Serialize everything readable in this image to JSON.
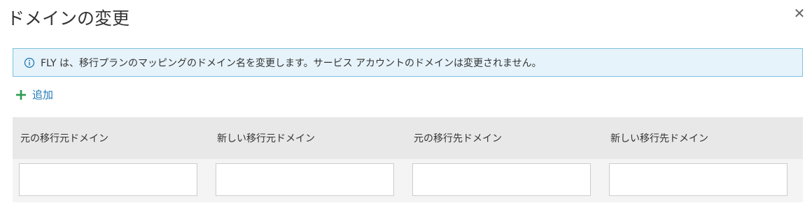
{
  "dialog": {
    "title": "ドメインの変更",
    "close_symbol": "✕",
    "info": {
      "icon": "info-icon",
      "text": "FLY は、移行プランのマッピングのドメイン名を変更します。サービス アカウントのドメインは変更されません。"
    },
    "add": {
      "icon": "plus-icon",
      "label": "追加"
    },
    "table": {
      "columns": [
        "元の移行元ドメイン",
        "新しい移行元ドメイン",
        "元の移行先ドメイン",
        "新しい移行先ドメイン"
      ],
      "row": [
        "",
        "",
        "",
        ""
      ]
    },
    "colors": {
      "accent": "#1f78b4",
      "add_icon": "#2e9a52",
      "banner_bg": "#e6f3fa",
      "banner_border": "#7ec1e0"
    }
  }
}
